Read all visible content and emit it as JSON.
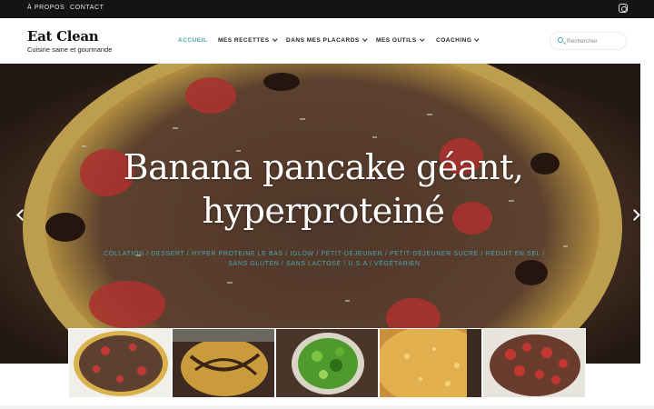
{
  "topbar": {
    "links": [
      "À PROPOS",
      "CONTACT"
    ],
    "social_icon": "instagram-icon"
  },
  "brand": {
    "title": "Eat Clean",
    "tagline": "Cuisine saine et gourmande"
  },
  "nav": [
    {
      "label": "ACCUEIL",
      "active": true,
      "dropdown": false
    },
    {
      "label": "MES RECETTES",
      "active": false,
      "dropdown": true
    },
    {
      "label": "DANS MES PLACARDS",
      "active": false,
      "dropdown": true
    },
    {
      "label": "MES OUTILS",
      "active": false,
      "dropdown": true
    },
    {
      "label": "COACHING",
      "active": false,
      "dropdown": true
    }
  ],
  "search": {
    "placeholder": "Rechercher",
    "value": ""
  },
  "hero": {
    "title_line1": "Banana pancake géant,",
    "title_line2": "hyperproteiné",
    "categories_line1": "COLLATION / DESSERT / HYPER PROTEINE LE BAS / IGLOW / PETIT-DÉJEUNER / PETIT-DÉJEUNER SUCRE / RÉDUIT EN SEL /",
    "categories_line2": "SANS GLUTEN / SANS LACTOSE / U.S.A / VÉGÉTARIEN"
  },
  "thumbnails": [
    {
      "label": "banana-pancake"
    },
    {
      "label": "chocolate-cake"
    },
    {
      "label": "green-peppers"
    },
    {
      "label": "tart"
    },
    {
      "label": "strawberry-dessert"
    }
  ],
  "colors": {
    "accent": "#4aa6b2",
    "topbar": "#141414"
  }
}
